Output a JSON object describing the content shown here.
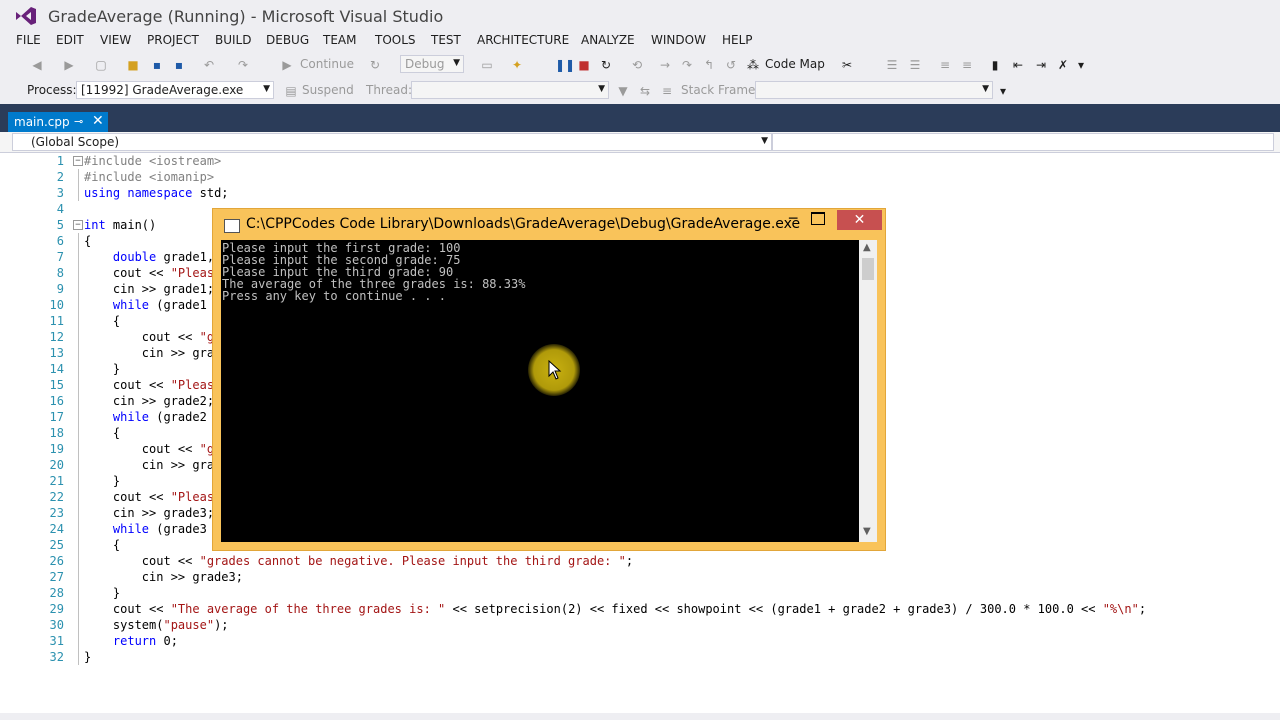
{
  "window": {
    "title": "GradeAverage (Running) - Microsoft Visual Studio"
  },
  "menu": [
    "FILE",
    "EDIT",
    "VIEW",
    "PROJECT",
    "BUILD",
    "DEBUG",
    "TEAM",
    "TOOLS",
    "TEST",
    "ARCHITECTURE",
    "ANALYZE",
    "WINDOW",
    "HELP"
  ],
  "toolbar1": {
    "continue_label": "Continue",
    "config_value": "Debug",
    "codemap_label": "Code Map"
  },
  "toolbar2": {
    "process_label": "Process:",
    "process_value": "[11992] GradeAverage.exe",
    "suspend_label": "Suspend",
    "thread_label": "Thread:",
    "stackframe_label": "Stack Frame:"
  },
  "tab": {
    "label": "main.cpp",
    "pin": "⊸",
    "close": "✕"
  },
  "scope": {
    "value": "(Global Scope)"
  },
  "code_lines": [
    {
      "n": "1",
      "segs": [
        {
          "t": "#include <iostream>",
          "c": "pp"
        }
      ]
    },
    {
      "n": "2",
      "segs": [
        {
          "t": "#include <iomanip>",
          "c": "pp"
        }
      ]
    },
    {
      "n": "3",
      "segs": [
        {
          "t": "using",
          "c": "kw"
        },
        {
          "t": " "
        },
        {
          "t": "namespace",
          "c": "kw"
        },
        {
          "t": " std;"
        }
      ]
    },
    {
      "n": "4",
      "segs": []
    },
    {
      "n": "5",
      "segs": [
        {
          "t": "int",
          "c": "kw"
        },
        {
          "t": " main()"
        }
      ]
    },
    {
      "n": "6",
      "segs": [
        {
          "t": "{"
        }
      ]
    },
    {
      "n": "7",
      "segs": [
        {
          "t": "    "
        },
        {
          "t": "double",
          "c": "kw"
        },
        {
          "t": " grade1,"
        }
      ]
    },
    {
      "n": "8",
      "segs": [
        {
          "t": "    cout << "
        },
        {
          "t": "\"Pleas",
          "c": "str"
        }
      ]
    },
    {
      "n": "9",
      "segs": [
        {
          "t": "    cin >> grade1;"
        }
      ]
    },
    {
      "n": "10",
      "segs": [
        {
          "t": "    "
        },
        {
          "t": "while",
          "c": "kw"
        },
        {
          "t": " (grade1 "
        }
      ]
    },
    {
      "n": "11",
      "segs": [
        {
          "t": "    {"
        }
      ]
    },
    {
      "n": "12",
      "segs": [
        {
          "t": "        cout << "
        },
        {
          "t": "\"g",
          "c": "str"
        }
      ]
    },
    {
      "n": "13",
      "segs": [
        {
          "t": "        cin >> gra"
        }
      ]
    },
    {
      "n": "14",
      "segs": [
        {
          "t": "    }"
        }
      ]
    },
    {
      "n": "15",
      "segs": [
        {
          "t": "    cout << "
        },
        {
          "t": "\"Pleas",
          "c": "str"
        }
      ]
    },
    {
      "n": "16",
      "segs": [
        {
          "t": "    cin >> grade2;"
        }
      ]
    },
    {
      "n": "17",
      "segs": [
        {
          "t": "    "
        },
        {
          "t": "while",
          "c": "kw"
        },
        {
          "t": " (grade2 "
        }
      ]
    },
    {
      "n": "18",
      "segs": [
        {
          "t": "    {"
        }
      ]
    },
    {
      "n": "19",
      "segs": [
        {
          "t": "        cout << "
        },
        {
          "t": "\"g",
          "c": "str"
        }
      ]
    },
    {
      "n": "20",
      "segs": [
        {
          "t": "        cin >> gra"
        }
      ]
    },
    {
      "n": "21",
      "segs": [
        {
          "t": "    }"
        }
      ]
    },
    {
      "n": "22",
      "segs": [
        {
          "t": "    cout << "
        },
        {
          "t": "\"Pleas",
          "c": "str"
        }
      ]
    },
    {
      "n": "23",
      "segs": [
        {
          "t": "    cin >> grade3;"
        }
      ]
    },
    {
      "n": "24",
      "segs": [
        {
          "t": "    "
        },
        {
          "t": "while",
          "c": "kw"
        },
        {
          "t": " (grade3 "
        }
      ]
    },
    {
      "n": "25",
      "segs": [
        {
          "t": "    {"
        }
      ]
    },
    {
      "n": "26",
      "segs": [
        {
          "t": "        cout << "
        },
        {
          "t": "\"grades cannot be negative. Please input the third grade: \"",
          "c": "str"
        },
        {
          "t": ";"
        }
      ]
    },
    {
      "n": "27",
      "segs": [
        {
          "t": "        cin >> grade3;"
        }
      ]
    },
    {
      "n": "28",
      "segs": [
        {
          "t": "    }"
        }
      ]
    },
    {
      "n": "29",
      "segs": [
        {
          "t": "    cout << "
        },
        {
          "t": "\"The average of the three grades is: \"",
          "c": "str"
        },
        {
          "t": " << setprecision(2) << fixed << showpoint << (grade1 + grade2 + grade3) / 300.0 * 100.0 << "
        },
        {
          "t": "\"%\\n\"",
          "c": "str"
        },
        {
          "t": ";"
        }
      ]
    },
    {
      "n": "30",
      "segs": [
        {
          "t": "    system("
        },
        {
          "t": "\"pause\"",
          "c": "str"
        },
        {
          "t": ");"
        }
      ]
    },
    {
      "n": "31",
      "segs": [
        {
          "t": "    "
        },
        {
          "t": "return",
          "c": "kw"
        },
        {
          "t": " 0;"
        }
      ]
    },
    {
      "n": "32",
      "segs": [
        {
          "t": "}"
        }
      ]
    }
  ],
  "console": {
    "title": "C:\\CPPCodes Code Library\\Downloads\\GradeAverage\\Debug\\GradeAverage.exe",
    "lines": [
      "Please input the first grade: 100",
      "Please input the second grade: 75",
      "Please input the third grade: 90",
      "The average of the three grades is: 88.33%",
      "Press any key to continue . . ."
    ],
    "minimize": "─",
    "close": "✕"
  },
  "colors": {
    "accent": "#007acc",
    "tabstrip": "#2b3c59",
    "console_frame": "#f9c35a",
    "close_red": "#c75050"
  }
}
